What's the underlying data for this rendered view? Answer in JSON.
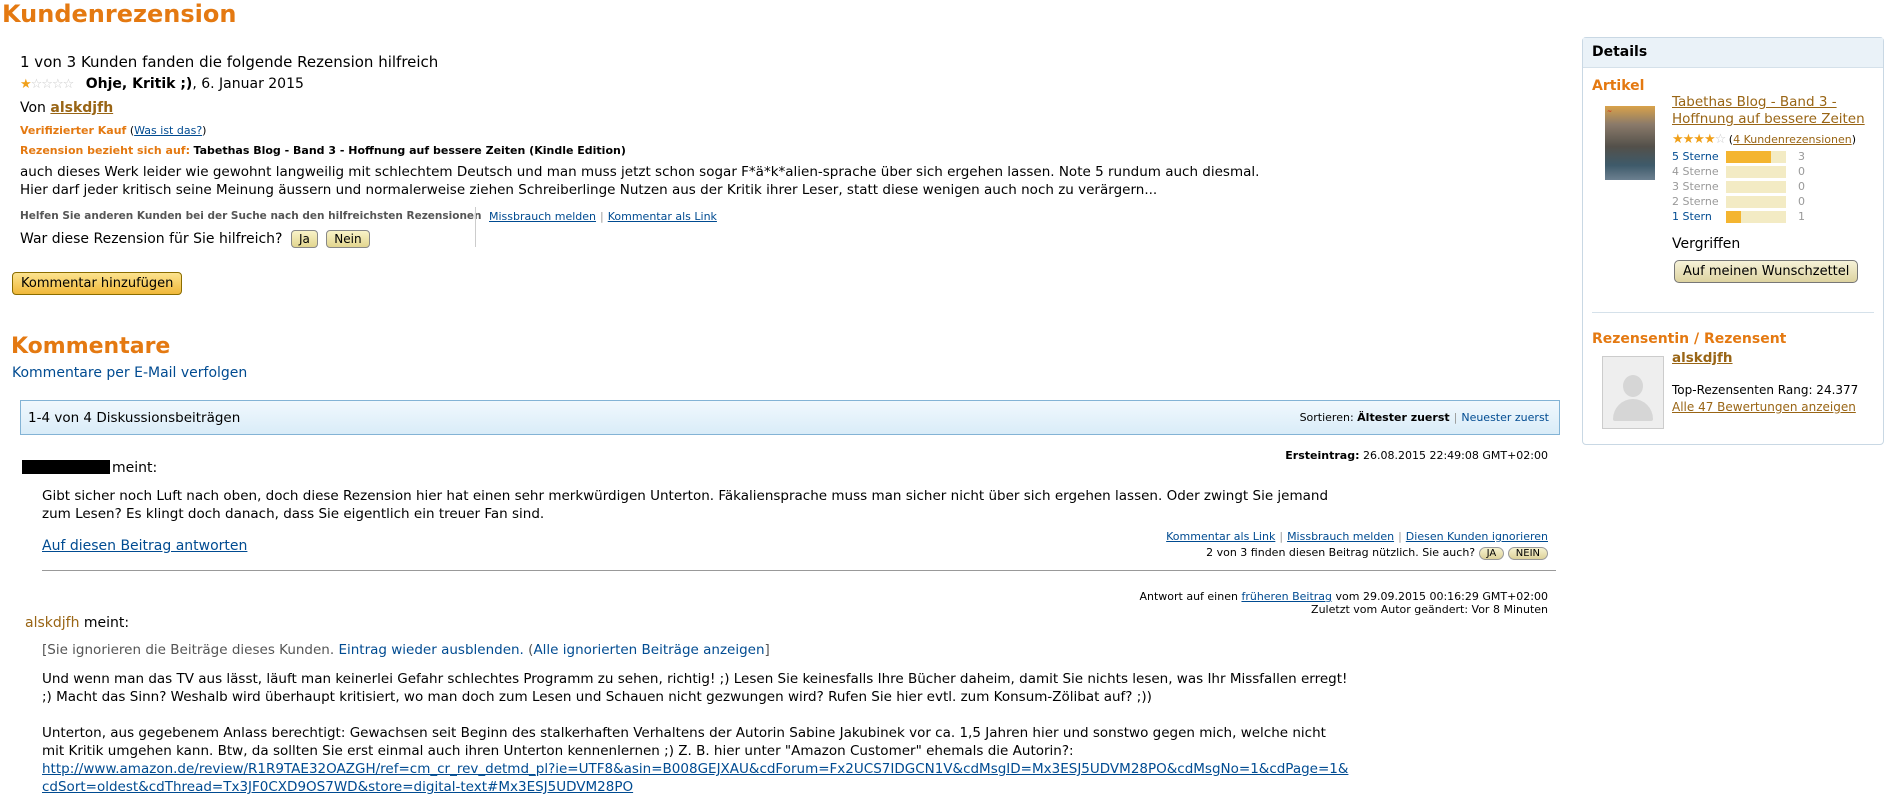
{
  "main_title": "Kundenrezension",
  "review": {
    "helpful_count": "1 von 3 Kunden fanden die folgende Rezension hilfreich",
    "rating": 1,
    "rating_max": 5,
    "title": "Ohje, Kritik ;)",
    "date": ", 6. Januar 2015",
    "by_prefix": "Von",
    "author": "alskdjfh",
    "verified_label": "Verifizierter Kauf",
    "verified_link": "Was ist das?",
    "refers_label": "Rezension bezieht sich auf:",
    "refers_product": "Tabethas Blog - Band 3 - Hoffnung auf bessere Zeiten (Kindle Edition)",
    "body_line1": "auch dieses Werk leider wie gewohnt langweilig mit schlechtem Deutsch und man muss jetzt schon sogar F*ä*k*alien-sprache über sich ergehen lassen. Note 5 rundum auch diesmal.",
    "body_line2": "Hier darf jeder kritisch seine Meinung äussern und normalerweise ziehen Schreiberlinge Nutzen aus der Kritik ihrer Leser, statt diese wenigen auch noch zu verärgern...",
    "help_others": "Helfen Sie anderen Kunden bei der Suche nach den hilfreichsten Rezensionen",
    "was_helpful": "War diese Rezension für Sie hilfreich?",
    "yes": "Ja",
    "no": "Nein",
    "report_abuse": "Missbrauch melden",
    "comment_as_link": "Kommentar als Link",
    "add_comment": "Kommentar hinzufügen"
  },
  "comments": {
    "title": "Kommentare",
    "follow_email": "Kommentare per E-Mail verfolgen",
    "count_text": "1-4 von 4 Diskussionsbeiträgen",
    "sort_label": "Sortieren:",
    "sort_oldest": "Ältester zuerst",
    "sort_newest": "Neuester zuerst",
    "post1": {
      "meint": "meint:",
      "first_entry_label": "Ersteintrag:",
      "first_entry_date": "26.08.2015 22:49:08 GMT+02:00",
      "text_line1": "Gibt sicher noch Luft nach oben, doch diese Rezension hier hat einen sehr merkwürdigen Unterton. Fäkaliensprache muss man sicher nicht über sich ergehen lassen. Oder zwingt Sie jemand",
      "text_line2": "zum Lesen? Es klingt doch danach, dass Sie eigentlich ein treuer Fan sind.",
      "reply": "Auf diesen Beitrag antworten",
      "comment_as_link": "Kommentar als Link",
      "report_abuse": "Missbrauch melden",
      "ignore_customer": "Diesen Kunden ignorieren",
      "useful_text": "2 von 3 finden diesen Beitrag nützlich. Sie auch?",
      "yes": "JA",
      "no": "NEIN"
    },
    "post2": {
      "answer_prefix": "Antwort auf einen",
      "answer_link": "früheren Beitrag",
      "answer_suffix": "vom 29.09.2015 00:16:29 GMT+02:00",
      "last_changed": "Zuletzt vom Autor geändert: Vor 8 Minuten",
      "author": "alskdjfh",
      "meint": "meint:",
      "ignore_notice_pre": "[Sie ignorieren die Beiträge dieses Kunden.",
      "hide_link": "Eintrag wieder ausblenden.",
      "show_all_link": "Alle ignorierten Beiträge anzeigen",
      "ignore_notice_post": "]",
      "p1_line1": "Und wenn man das TV aus lässt, läuft man keinerlei Gefahr schlechtes Programm zu sehen, richtig! ;) Lesen Sie keinesfalls Ihre Bücher daheim, damit Sie nichts lesen, was Ihr Missfallen erregt!",
      "p1_line2": ";) Macht das Sinn? Weshalb wird überhaupt kritisiert, wo man doch zum Lesen und Schauen nicht gezwungen wird? Rufen Sie hier evtl. zum Konsum-Zölibat auf? ;))",
      "p2_line1": "Unterton, aus gegebenem Anlass berechtigt: Gewachsen seit Beginn des stalkerhaften Verhaltens der Autorin Sabine Jakubinek vor ca. 1,5 Jahren hier und sonstwo gegen mich, welche nicht",
      "p2_line2": "mit Kritik umgehen kann. Btw, da sollten Sie erst einmal auch ihren Unterton kennenlernen ;) Z. B. hier unter \"Amazon Customer\" ehemals die Autorin?:",
      "url_line1": "http://www.amazon.de/review/R1R9TAE32OAZGH/ref=cm_cr_rev_detmd_pl?ie=UTF8&asin=B008GEJXAU&cdForum=Fx2UCS7IDGCN1V&cdMsgID=Mx3ESJ5UDVM28PO&cdMsgNo=1&cdPage=1&",
      "url_line2": "cdSort=oldest&cdThread=Tx3JF0CXD9OS7WD&store=digital-text#Mx3ESJ5UDVM28PO"
    }
  },
  "details": {
    "header": "Details",
    "article_label": "Artikel",
    "product_title": "Tabethas Blog - Band 3 - Hoffnung auf bessere Zeiten",
    "avg_rating": 4,
    "reviews_link": "4 Kundenrezensionen",
    "histogram": [
      {
        "label": "5 Sterne",
        "count": "3",
        "fraction": 0.75,
        "active": true
      },
      {
        "label": "4 Sterne",
        "count": "0",
        "fraction": 0,
        "active": false
      },
      {
        "label": "3 Sterne",
        "count": "0",
        "fraction": 0,
        "active": false
      },
      {
        "label": "2 Sterne",
        "count": "0",
        "fraction": 0,
        "active": false
      },
      {
        "label": "1 Stern",
        "count": "1",
        "fraction": 0.25,
        "active": true
      }
    ],
    "availability": "Vergriffen",
    "wishlist_button": "Auf meinen Wunschzettel",
    "reviewer_label": "Rezensentin / Rezensent",
    "reviewer_name": "alskdjfh",
    "top_rank": "Top-Rezensenten Rang: 24.377",
    "all_ratings_link": "Alle 47 Bewertungen anzeigen"
  }
}
